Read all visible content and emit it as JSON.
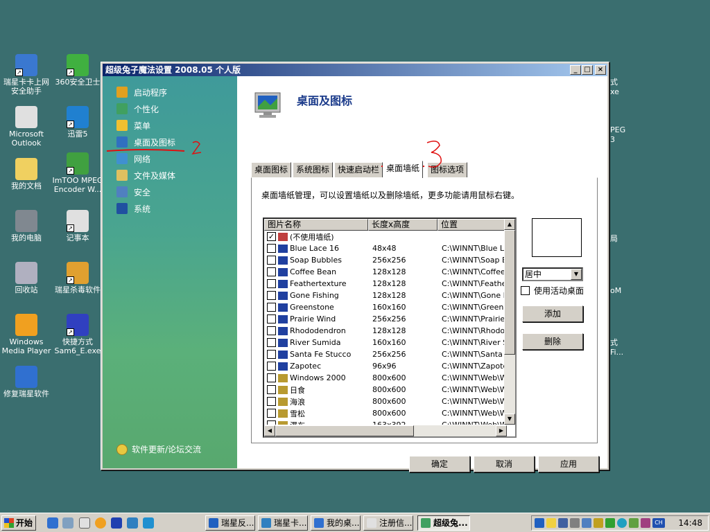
{
  "desktop": {
    "icons": [
      {
        "label": "瑞星卡卡上网安全助手"
      },
      {
        "label": "360安全卫士"
      },
      {
        "label": "Microsoft Outlook"
      },
      {
        "label": "迅雷5"
      },
      {
        "label": "我的文档"
      },
      {
        "label": "ImTOO MPEG Encoder W..."
      },
      {
        "label": "我的电脑"
      },
      {
        "label": "记事本"
      },
      {
        "label": "回收站"
      },
      {
        "label": "瑞星杀毒软件"
      },
      {
        "label": "Windows Media Player"
      },
      {
        "label": "快捷方式 Sam6_E.exe"
      },
      {
        "label": "修复瑞星软件"
      }
    ],
    "partial_right": [
      "式",
      "xe",
      "PEG",
      "3",
      "局",
      "oM",
      "式",
      "Fi..."
    ]
  },
  "window": {
    "title": "超级兔子魔法设置 2008.05 个人版",
    "controls": {
      "minimize": "_",
      "maximize": "□",
      "close": "×"
    }
  },
  "sidebar": {
    "items": [
      {
        "label": "启动程序",
        "icon": "startup-icon"
      },
      {
        "label": "个性化",
        "icon": "personalize-icon"
      },
      {
        "label": "菜单",
        "icon": "menu-icon"
      },
      {
        "label": "桌面及图标",
        "icon": "desktop-icon"
      },
      {
        "label": "网络",
        "icon": "network-icon"
      },
      {
        "label": "文件及媒体",
        "icon": "file-media-icon"
      },
      {
        "label": "安全",
        "icon": "security-icon"
      },
      {
        "label": "系统",
        "icon": "system-icon"
      }
    ],
    "footer": "软件更新/论坛交流"
  },
  "main": {
    "title": "桌面及图标",
    "tabs": [
      "桌面图标",
      "系统图标",
      "快速启动栏",
      "桌面墙纸",
      "图标选项"
    ],
    "active_tab": "桌面墙纸",
    "description": "桌面墙纸管理，可以设置墙纸以及删除墙纸，更多功能请用鼠标右键。",
    "wallpaper_list": {
      "columns": [
        "图片名称",
        "长度x高度",
        "位置"
      ],
      "rows": [
        {
          "name": "(不使用墙纸)",
          "size": "",
          "path": "",
          "checked": true,
          "type": "none"
        },
        {
          "name": "Blue Lace 16",
          "size": "48x48",
          "path": "C:\\WINNT\\Blue Lace",
          "checked": false,
          "type": "bmp"
        },
        {
          "name": "Soap Bubbles",
          "size": "256x256",
          "path": "C:\\WINNT\\Soap Bu",
          "checked": false,
          "type": "bmp"
        },
        {
          "name": "Coffee Bean",
          "size": "128x128",
          "path": "C:\\WINNT\\Coffee B",
          "checked": false,
          "type": "bmp"
        },
        {
          "name": "Feathertexture",
          "size": "128x128",
          "path": "C:\\WINNT\\Feather",
          "checked": false,
          "type": "bmp"
        },
        {
          "name": "Gone Fishing",
          "size": "128x128",
          "path": "C:\\WINNT\\Gone Fis",
          "checked": false,
          "type": "bmp"
        },
        {
          "name": "Greenstone",
          "size": "160x160",
          "path": "C:\\WINNT\\Greenst",
          "checked": false,
          "type": "bmp"
        },
        {
          "name": "Prairie Wind",
          "size": "256x256",
          "path": "C:\\WINNT\\Prairie W",
          "checked": false,
          "type": "bmp"
        },
        {
          "name": "Rhododendron",
          "size": "128x128",
          "path": "C:\\WINNT\\Rhododd",
          "checked": false,
          "type": "bmp"
        },
        {
          "name": "River Sumida",
          "size": "160x160",
          "path": "C:\\WINNT\\River Su",
          "checked": false,
          "type": "bmp"
        },
        {
          "name": "Santa Fe Stucco",
          "size": "256x256",
          "path": "C:\\WINNT\\Santa Fe",
          "checked": false,
          "type": "bmp"
        },
        {
          "name": "Zapotec",
          "size": "96x96",
          "path": "C:\\WINNT\\Zapotec",
          "checked": false,
          "type": "bmp"
        },
        {
          "name": "Windows 2000",
          "size": "800x600",
          "path": "C:\\WINNT\\Web\\Wa",
          "checked": false,
          "type": "jpg"
        },
        {
          "name": "日食",
          "size": "800x600",
          "path": "C:\\WINNT\\Web\\Wa",
          "checked": false,
          "type": "jpg"
        },
        {
          "name": "海浪",
          "size": "800x600",
          "path": "C:\\WINNT\\Web\\Wa",
          "checked": false,
          "type": "jpg"
        },
        {
          "name": "雪松",
          "size": "800x600",
          "path": "C:\\WINNT\\Web\\Wa",
          "checked": false,
          "type": "jpg"
        },
        {
          "name": "瀑布",
          "size": "163x392",
          "path": "C:\\WINNT\\Web\\Wa",
          "checked": false,
          "type": "jpg"
        }
      ]
    },
    "position": "居中",
    "active_desktop": "使用活动桌面",
    "add_button": "添加",
    "delete_button": "删除"
  },
  "buttons": {
    "ok": "确定",
    "cancel": "取消",
    "apply": "应用"
  },
  "taskbar": {
    "start": "开始",
    "tasks": [
      "瑞星反...",
      "瑞星卡...",
      "我的桌...",
      "注册信...",
      "超级兔..."
    ],
    "active_task": "超级兔...",
    "clock": "14:48",
    "ime": "CH"
  },
  "colors": {
    "desktop": "#3a6e6f",
    "titlebar_start": "#0a246a",
    "sidebar_green": "#4aa58f",
    "annotation_red": "#e01010"
  }
}
